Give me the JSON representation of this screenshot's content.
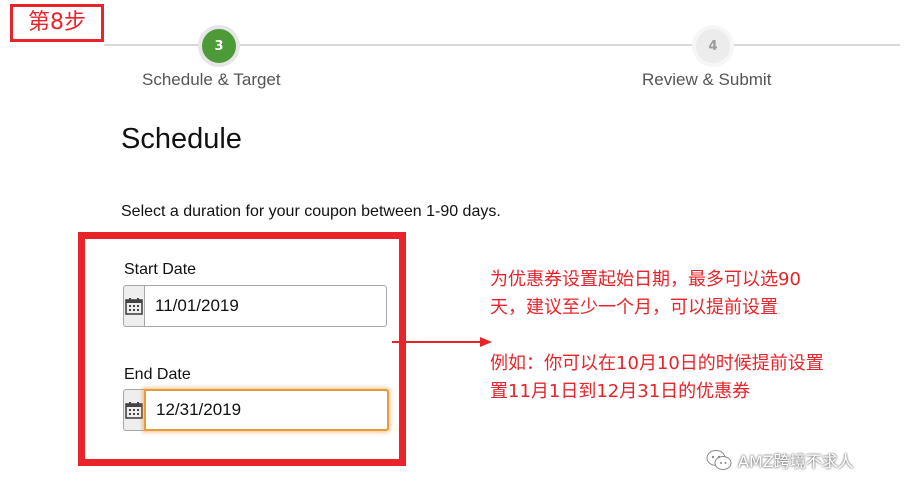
{
  "annotation": {
    "step_tag": "第8步",
    "note_line1": "为优惠券设置起始日期，最多可以选90",
    "note_line2": "天，建议至少一个月，可以提前设置",
    "note_line3": "例如：你可以在10月10日的时候提前设置",
    "note_line4": "置11月1日到12月31日的优惠券",
    "color": "#e8242a"
  },
  "stepper": {
    "steps": [
      {
        "number": "3",
        "label": "Schedule & Target",
        "state": "active",
        "color": "#4c9a38"
      },
      {
        "number": "4",
        "label": "Review & Submit",
        "state": "upcoming"
      }
    ]
  },
  "schedule": {
    "heading": "Schedule",
    "description": "Select a duration for your coupon between 1-90 days.",
    "start_date": {
      "label": "Start Date",
      "value": "11/01/2019",
      "icon": "calendar-icon"
    },
    "end_date": {
      "label": "End Date",
      "value": "12/31/2019",
      "icon": "calendar-icon",
      "focused": true
    }
  },
  "watermark": {
    "text": "AMZ跨境不求人",
    "icon": "wechat-icon"
  }
}
